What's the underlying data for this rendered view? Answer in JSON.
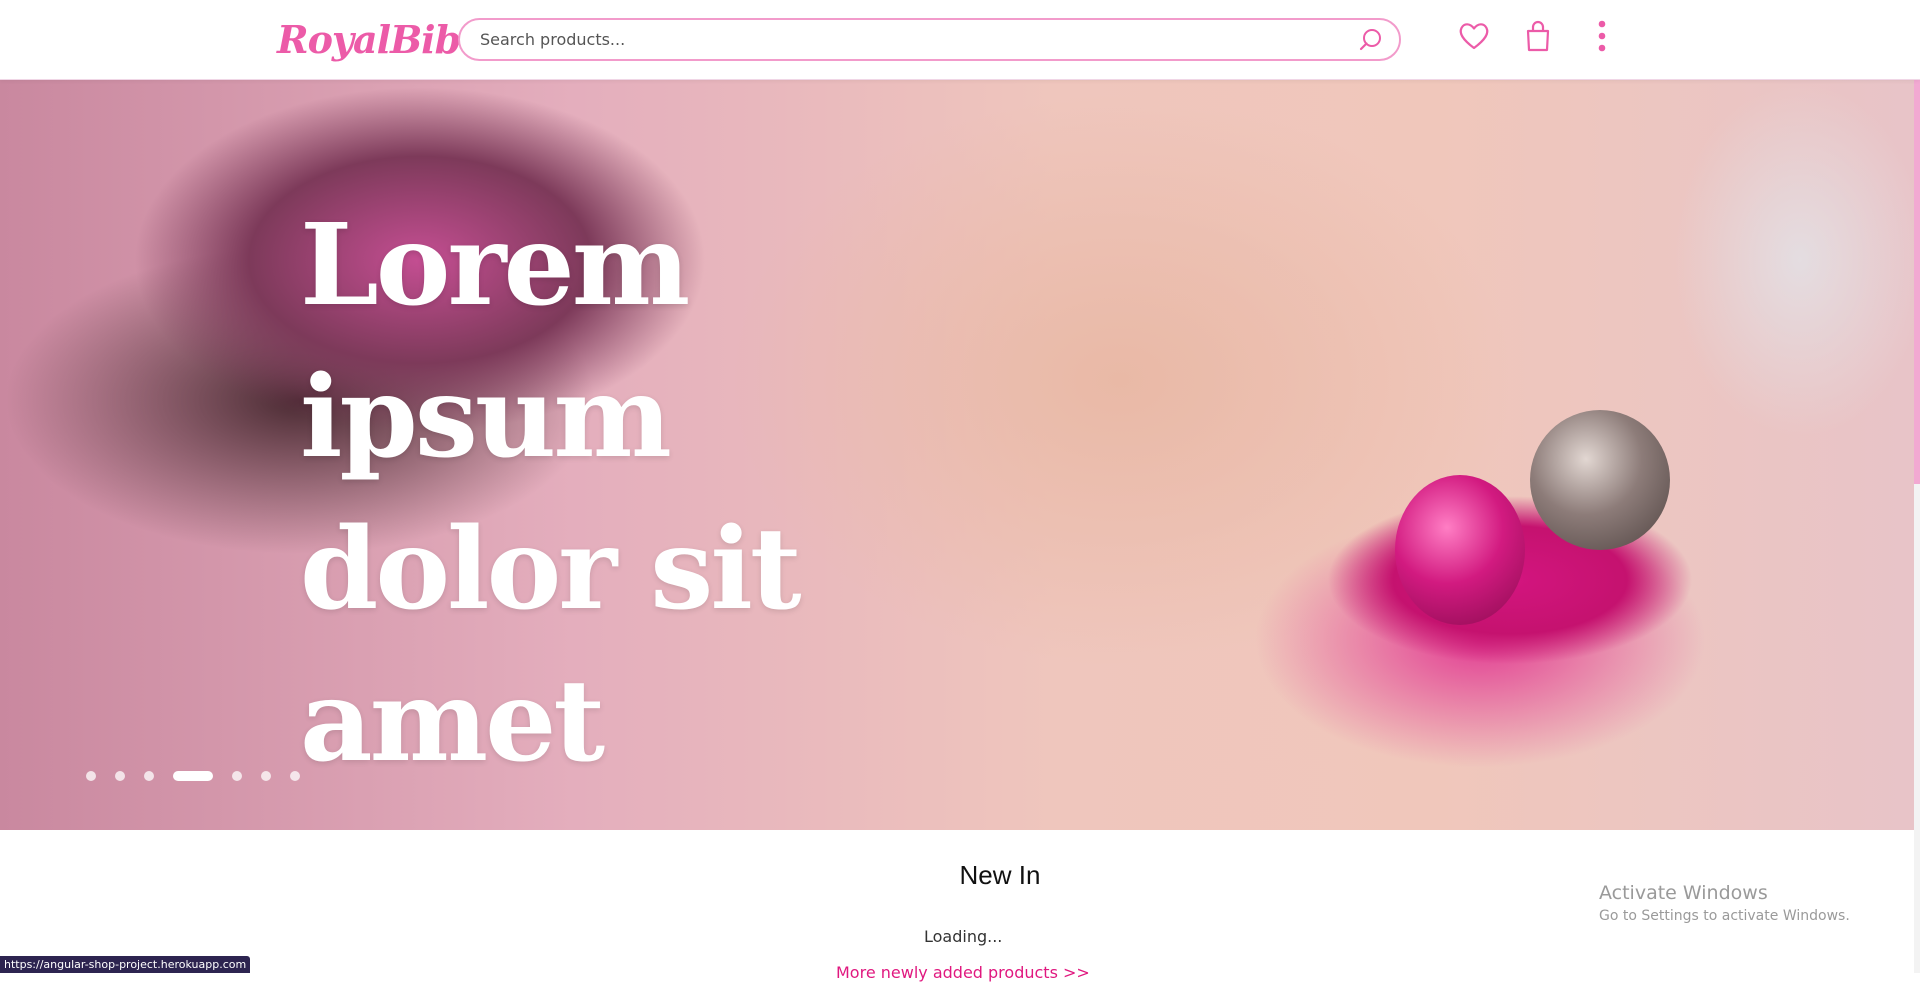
{
  "header": {
    "logo_text": "RoyalBiba",
    "search": {
      "placeholder": "Search products...",
      "value": ""
    },
    "icons": [
      "search-icon",
      "heart-icon",
      "shopping-bag-icon",
      "more-vertical-icon"
    ]
  },
  "hero": {
    "title": "Lorem ipsum dolor sit amet",
    "slides_count": 7,
    "active_slide": 4
  },
  "new_in": {
    "title": "New In",
    "loading_text": "Loading...",
    "more_link": "More newly added products >>"
  },
  "watermark": {
    "title": "Activate Windows",
    "subtitle": "Go to Settings to activate Windows."
  },
  "status_bar": {
    "url": "https://angular-shop-project.herokuapp.com"
  },
  "colors": {
    "brand_pink": "#ec5ba8",
    "link_pink": "#e0187f",
    "search_border": "#f29bcb"
  }
}
